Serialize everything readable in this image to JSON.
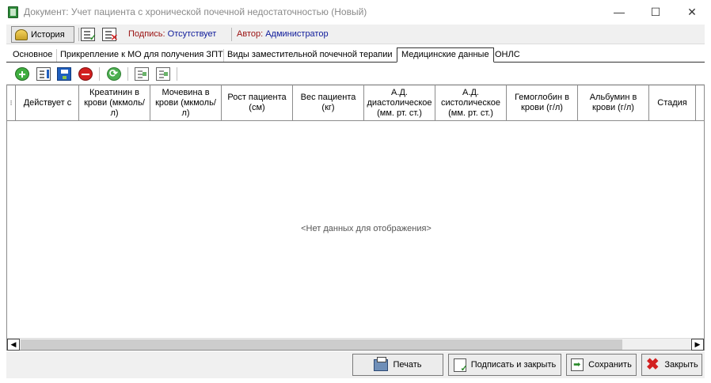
{
  "window": {
    "title": "Документ: Учет пациента с хронической почечной недостаточностью (Новый)",
    "controls": {
      "minimize": "—",
      "maximize": "☐",
      "close": "✕"
    }
  },
  "toolbar": {
    "history_label": "История",
    "sign_label": "Подпись:",
    "sign_value": "Отсутствует",
    "author_label": "Автор:",
    "author_value": "Администратор"
  },
  "tabs": [
    {
      "label": "Основное"
    },
    {
      "label": "Прикрепление к МО для получения ЗПТ"
    },
    {
      "label": "Виды заместительной почечной терапии"
    },
    {
      "label": "Медицинские данные",
      "active": true
    },
    {
      "label": "ОНЛС"
    }
  ],
  "grid": {
    "indicator": "⁝",
    "columns": [
      "Действует с",
      "Креатинин в крови (мкмоль/л)",
      "Мочевина в крови (мкмоль/л)",
      "Рост пациента (см)",
      "Вес пациента (кг)",
      "А.Д. диастолическое (мм. рт. ст.)",
      "А.Д. систолическое (мм. рт. ст.)",
      "Гемоглобин в крови (г/л)",
      "Альбумин в крови (г/л)",
      "Стадия"
    ],
    "empty_message": "<Нет данных для отображения>",
    "scroll_left": "◀",
    "scroll_right": "▶"
  },
  "footer": {
    "print_label": "Печать",
    "sign_close_label": "Подписать и закрыть",
    "save_label": "Сохранить",
    "close_label": "Закрыть"
  },
  "colors": {
    "sign_label": "#9a1010",
    "sign_value": "#0d1a9a",
    "add_icon": "#3fae3f",
    "delete_icon": "#d21f1f",
    "close_icon": "#d21f1f"
  }
}
